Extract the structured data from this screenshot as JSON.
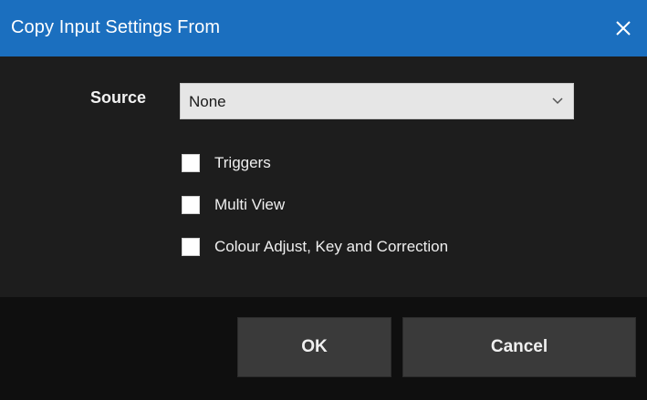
{
  "window": {
    "title": "Copy Input Settings From",
    "close_icon": "close-icon"
  },
  "form": {
    "source_label": "Source",
    "source_selected": "None",
    "dropdown_icon": "chevron-down-icon"
  },
  "options": [
    {
      "label": "Triggers",
      "checked": false
    },
    {
      "label": "Multi View",
      "checked": false
    },
    {
      "label": "Colour Adjust, Key and Correction",
      "checked": false
    }
  ],
  "buttons": {
    "ok_label": "OK",
    "cancel_label": "Cancel"
  },
  "colors": {
    "titlebar": "#1b6fbf",
    "background": "#1d1d1d",
    "footer": "#0f0f0f",
    "button": "#3a3a3a"
  }
}
